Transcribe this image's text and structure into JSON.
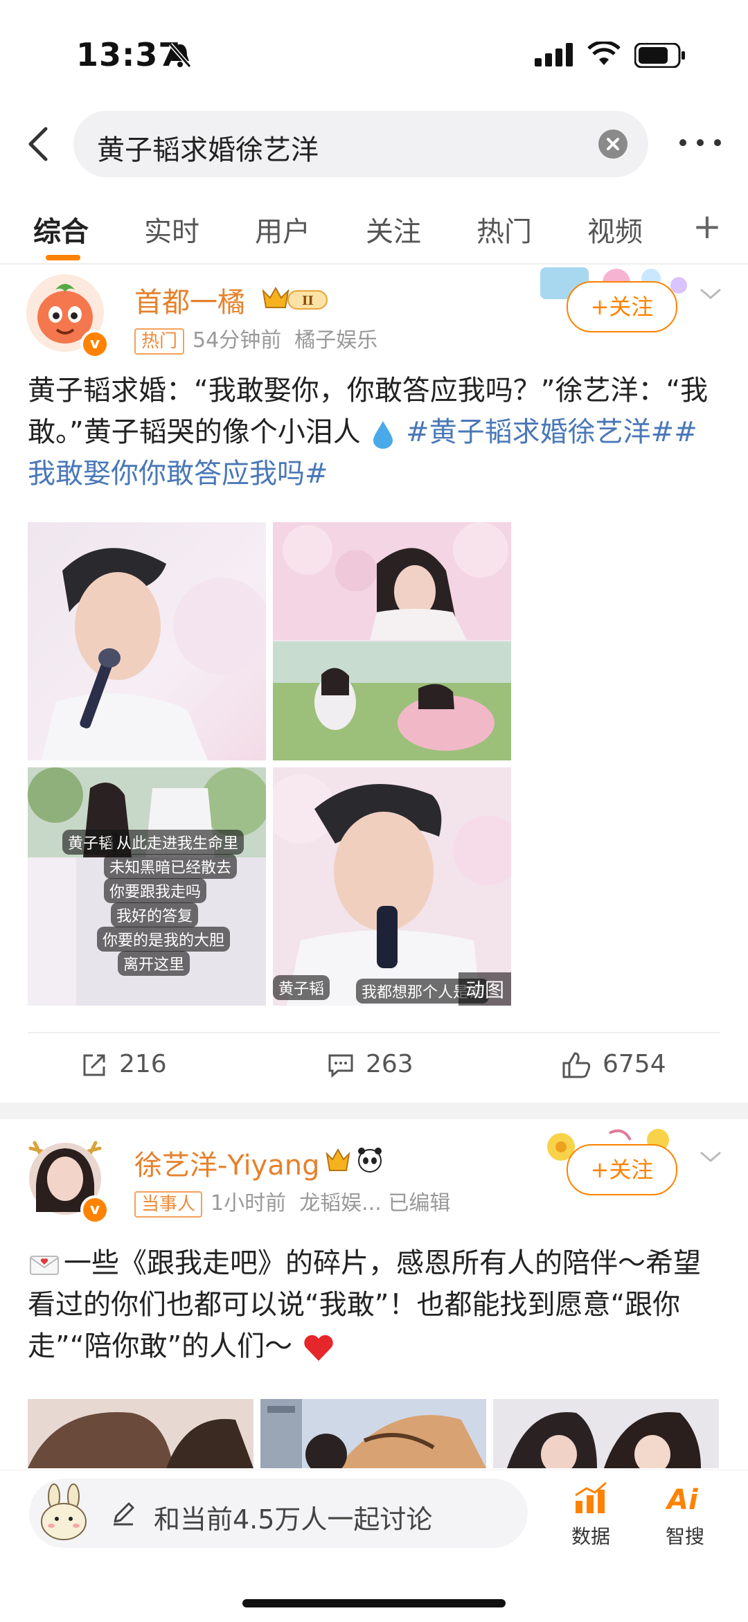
{
  "status_bar": {
    "time": "13:37"
  },
  "search": {
    "query": "黄子韬求婚徐艺洋"
  },
  "tabs": [
    {
      "label": "综合",
      "active": true
    },
    {
      "label": "实时"
    },
    {
      "label": "用户"
    },
    {
      "label": "关注"
    },
    {
      "label": "热门"
    },
    {
      "label": "视频"
    }
  ],
  "tabs_more": "+",
  "posts": [
    {
      "username": "首都一橘",
      "level_badge": "II",
      "tag": "热门",
      "time": "54分钟前",
      "source": "橘子娱乐",
      "follow_label": "+关注",
      "text_plain": "黄子韬求婚：“我敢娶你，你敢答应我吗？”徐艺洋：“我敢。”黄子韬哭的像个小泪人",
      "hashtag": "#黄子韬求婚徐艺洋##我敢娶你你敢答应我吗#",
      "image_subtitles": [
        "黄子韬",
        "从此走进我生命里",
        "未知黑暗已经散去",
        "你要跟我走吗",
        "我好的答复",
        "你要的是我的大胆",
        "离开这里",
        "黄子韬",
        "我都想那个人是谁"
      ],
      "gif_badge": "动图",
      "actions": {
        "repost": "216",
        "comments": "263",
        "likes": "6754"
      }
    },
    {
      "username": "徐艺洋-Yiyang",
      "tag": "当事人",
      "time": "1小时前",
      "source": "龙韬娱...",
      "edited": "已编辑",
      "follow_label": "+关注",
      "text": "一些《跟我走吧》的碎片，感恩所有人的陪伴～希望看过的你们也都可以说“我敢”！也都能找到愿意“跟你走”“陪你敢”的人们～"
    }
  ],
  "bottom_bar": {
    "discuss": "和当前4.5万人一起讨论",
    "data_label": "数据",
    "ai_label": "智搜"
  },
  "colors": {
    "accent": "#ff8200",
    "username": "#e5812c",
    "hashtag": "#4a78b8"
  }
}
